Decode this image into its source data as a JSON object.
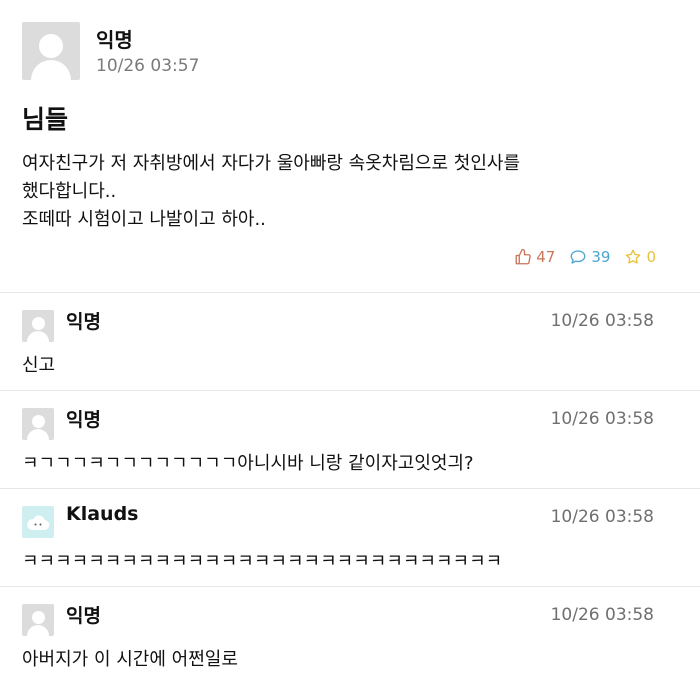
{
  "post": {
    "author": "익명",
    "time": "10/26 03:57",
    "title": "님들",
    "body": "여자친구가 저 자취방에서 자다가 울아빠랑 속옷차림으로 첫인사를\n했다합니다..\n조떼따 시험이고 나발이고 하아..",
    "likes": "47",
    "comments": "39",
    "scraps": "0"
  },
  "comments": [
    {
      "author": "익명",
      "time": "10/26 03:58",
      "text": "신고",
      "avatar": "default-avatar-icon"
    },
    {
      "author": "익명",
      "time": "10/26 03:58",
      "text": "ㅋㄱㄱㄱㅋㄱㄱㄱㄱㄱㄱㄱㄱ아니시바 니랑 같이자고잇엇긔?",
      "avatar": "default-avatar-icon"
    },
    {
      "author": "Klauds",
      "time": "10/26 03:58",
      "text": "ㅋㅋㅋㅋㅋㅋㅋㅋㅋㅋㅋㅋㅋㅋㅋㅋㅋㅋㅋㅋㅋㅋㅋㅋㅋㅋㅋㅋㅋ",
      "avatar": "cloud-avatar-icon"
    },
    {
      "author": "익명",
      "time": "10/26 03:58",
      "text": "아버지가 이 시간에 어쩐일로",
      "avatar": "default-avatar-icon"
    }
  ],
  "colors": {
    "like": "#c9765a",
    "comment": "#4aa7cf",
    "star": "#e6c23c",
    "divider": "#e6e6e6",
    "muted": "#7a7a7a"
  },
  "icons": {
    "like": "thumbs-up-icon",
    "comment": "speech-bubble-icon",
    "scrap": "star-icon"
  }
}
